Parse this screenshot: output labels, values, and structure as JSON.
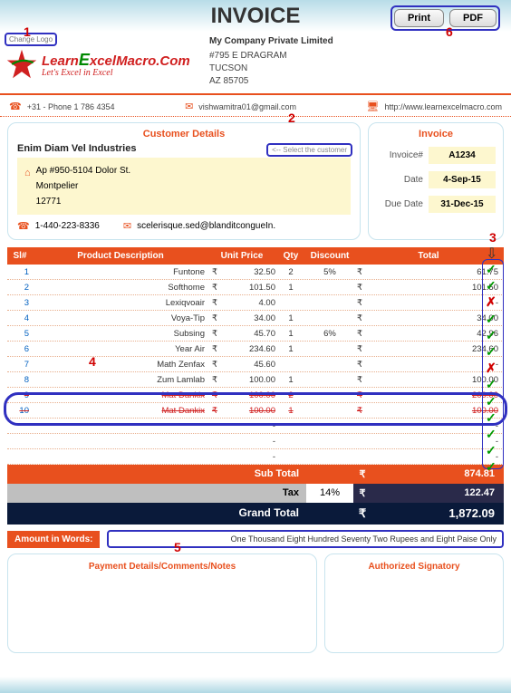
{
  "title": "INVOICE",
  "buttons": {
    "print": "Print",
    "pdf": "PDF"
  },
  "change_logo": "Change Logo",
  "logo": {
    "line1a": "Learn",
    "line1b": "E",
    "line1c": "xcelMacro.Com",
    "line2": "Let's Excel in Excel"
  },
  "company": {
    "name": "My Company Private Limited",
    "addr1": "#795 E DRAGRAM",
    "city": "TUCSON",
    "zip": "AZ 85705"
  },
  "contact": {
    "phone": "+31 - Phone 1 786 4354",
    "email": "vishwamitra01@gmail.com",
    "web": "http://www.learnexcelmacro.com"
  },
  "annot": {
    "a1": "1",
    "a2": "2",
    "a3": "3",
    "a4": "4",
    "a5": "5",
    "a6": "6"
  },
  "customer": {
    "title": "Customer Details",
    "select": "<-- Select the customer",
    "name": "Enim Diam Vel Industries",
    "addr1": "Ap #950-5104 Dolor St.",
    "addr2": "Montpelier",
    "addr3": "12771",
    "phone": "1-440-223-8336",
    "email": "scelerisque.sed@blanditcongueIn."
  },
  "invoice": {
    "title": "Invoice",
    "num_l": "Invoice#",
    "num": "A1234",
    "date_l": "Date",
    "date": "4-Sep-15",
    "due_l": "Due Date",
    "due": "31-Dec-15"
  },
  "cols": {
    "sl": "Sl#",
    "pd": "Product Description",
    "up": "Unit Price",
    "qty": "Qty",
    "disc": "Discount",
    "tot": "Total"
  },
  "cur": "₹",
  "items": [
    {
      "sl": "1",
      "pd": "Funtone",
      "up": "32.50",
      "qty": "2",
      "disc": "5%",
      "tot": "61.75",
      "chk": "g"
    },
    {
      "sl": "2",
      "pd": "Softhome",
      "up": "101.50",
      "qty": "1",
      "disc": "",
      "tot": "101.50",
      "chk": "g"
    },
    {
      "sl": "3",
      "pd": "Lexiqvoair",
      "up": "4.00",
      "qty": "",
      "disc": "",
      "tot": "-",
      "chk": "r"
    },
    {
      "sl": "4",
      "pd": "Voya-Tip",
      "up": "34.00",
      "qty": "1",
      "disc": "",
      "tot": "34.00",
      "chk": "g"
    },
    {
      "sl": "5",
      "pd": "Subsing",
      "up": "45.70",
      "qty": "1",
      "disc": "6%",
      "tot": "42.96",
      "chk": "g"
    },
    {
      "sl": "6",
      "pd": "Year Air",
      "up": "234.60",
      "qty": "1",
      "disc": "",
      "tot": "234.60",
      "chk": "g"
    },
    {
      "sl": "7",
      "pd": "Math Zenfax",
      "up": "45.60",
      "qty": "",
      "disc": "",
      "tot": "-",
      "chk": "r"
    },
    {
      "sl": "8",
      "pd": "Zum Lamlab",
      "up": "100.00",
      "qty": "1",
      "disc": "",
      "tot": "100.00",
      "chk": "g"
    },
    {
      "sl": "9",
      "pd": "Mat Dankix",
      "up": "100.00",
      "qty": "2",
      "disc": "",
      "tot": "200.00",
      "chk": "g",
      "strike": true
    },
    {
      "sl": "10",
      "pd": "Mat Dankix",
      "up": "100.00",
      "qty": "1",
      "disc": "",
      "tot": "100.00",
      "chk": "g",
      "strike": true
    },
    {
      "sl": "",
      "pd": "",
      "up": "-",
      "qty": "",
      "disc": "",
      "tot": "-",
      "chk": "g",
      "nocur": true
    },
    {
      "sl": "",
      "pd": "",
      "up": "-",
      "qty": "",
      "disc": "",
      "tot": "-",
      "chk": "g",
      "nocur": true
    },
    {
      "sl": "",
      "pd": "",
      "up": "-",
      "qty": "",
      "disc": "",
      "tot": "-",
      "chk": "g",
      "nocur": true
    }
  ],
  "totals": {
    "sub_l": "Sub Total",
    "sub": "874.81",
    "tax_l": "Tax",
    "tax_pct": "14%",
    "tax": "122.47",
    "gt_l": "Grand Total",
    "gt": "1,872.09"
  },
  "words_l": "Amount in Words:",
  "words": "One Thousand Eight Hundred Seventy Two Rupees and Eight Paise Only",
  "pay_t": "Payment Details/Comments/Notes",
  "sig_t": "Authorized Signatory"
}
